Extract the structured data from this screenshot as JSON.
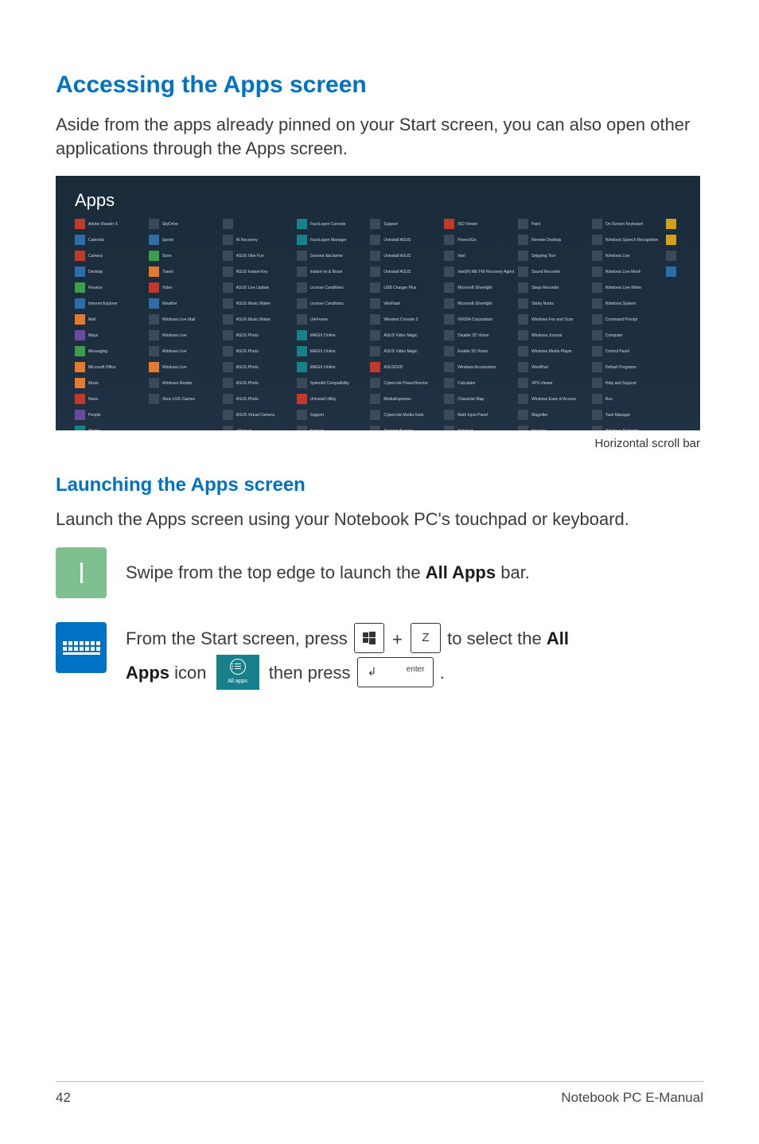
{
  "headings": {
    "main": "Accessing the Apps screen",
    "sub": "Launching the Apps screen"
  },
  "paragraphs": {
    "intro": "Aside from the apps already pinned on your Start screen, you can also open other applications through the Apps screen.",
    "launch": "Launch the Apps screen using your Notebook PC's touchpad or keyboard."
  },
  "screenshot": {
    "title": "Apps",
    "scroll_caption": "Horizontal scroll bar"
  },
  "instructions": {
    "touch": {
      "pre": "Swipe from the top edge to launch the ",
      "bold": "All Apps",
      "post": " bar."
    },
    "keyboard": {
      "line1_pre": "From the Start screen, press ",
      "line1_mid": " to select the ",
      "line1_bold": "All",
      "line2_bold": "Apps",
      "line2_mid": " icon ",
      "line2_then": " then press ",
      "key_z": "Z",
      "key_enter": "enter",
      "allapps_label": "All apps"
    }
  },
  "footer": {
    "page": "42",
    "title": "Notebook PC E-Manual"
  }
}
